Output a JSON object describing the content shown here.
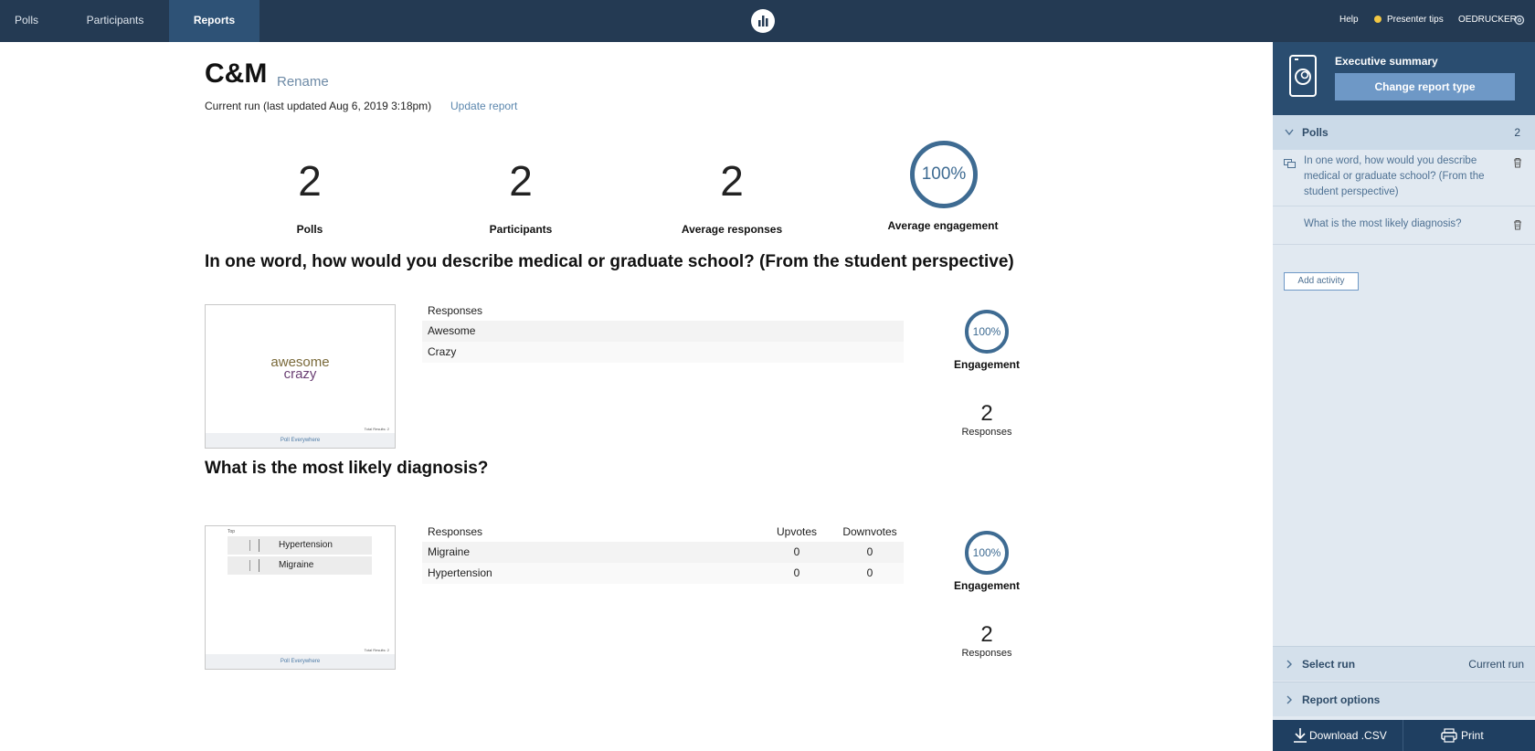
{
  "nav": {
    "tabs": [
      {
        "label": "Polls"
      },
      {
        "label": "Participants"
      },
      {
        "label": "Reports"
      }
    ],
    "help": "Help",
    "presenter_tips": "Presenter tips",
    "username": "OEDRUCKER"
  },
  "report": {
    "title": "C&M",
    "rename": "Rename",
    "subline": "Current run (last updated Aug 6, 2019 3:18pm)",
    "update": "Update report"
  },
  "stats": [
    {
      "value": "2",
      "label": "Polls"
    },
    {
      "value": "2",
      "label": "Participants"
    },
    {
      "value": "2",
      "label": "Average responses"
    },
    {
      "value": "100%",
      "label": "Average engagement"
    }
  ],
  "questions": [
    {
      "title": "In one word, how would you describe medical or graduate school? (From the student perspective)",
      "thumb_words": [
        "awesome",
        "crazy"
      ],
      "thumb_footer": "Poll Everywhere",
      "thumb_total": "Total Results: 2",
      "table_header": "Responses",
      "rows": [
        {
          "label": "Awesome"
        },
        {
          "label": "Crazy"
        }
      ],
      "engagement_value": "100%",
      "engagement_label": "Engagement",
      "responses_value": "2",
      "responses_label": "Responses"
    },
    {
      "title": "What is the most likely diagnosis?",
      "thumb_top": "Top",
      "thumb_items": [
        "Hypertension",
        "Migraine"
      ],
      "thumb_footer": "Poll Everywhere",
      "thumb_total": "Total Results: 2",
      "table_header": "Responses",
      "col_up": "Upvotes",
      "col_down": "Downvotes",
      "rows": [
        {
          "label": "Migraine",
          "up": "0",
          "down": "0"
        },
        {
          "label": "Hypertension",
          "up": "0",
          "down": "0"
        }
      ],
      "engagement_value": "100%",
      "engagement_label": "Engagement",
      "responses_value": "2",
      "responses_label": "Responses"
    }
  ],
  "sidebar": {
    "report_type": "Executive summary",
    "change_button": "Change report type",
    "polls_label": "Polls",
    "polls_count": "2",
    "items": [
      {
        "line1": "In one word, how would you describe",
        "line2": "medical or graduate school? (From the",
        "line3": "student perspective)"
      },
      {
        "line1": "What is the most likely diagnosis?"
      }
    ],
    "add_activity": "Add activity",
    "select_run": "Select run",
    "select_run_value": "Current run",
    "report_options": "Report options",
    "download": "Download .CSV",
    "print": "Print"
  },
  "colors": {
    "topbar": "#243a53",
    "active_tab": "#2e5276",
    "accent": "#3e6b92",
    "sidebar_bg": "#e1e9f1"
  }
}
